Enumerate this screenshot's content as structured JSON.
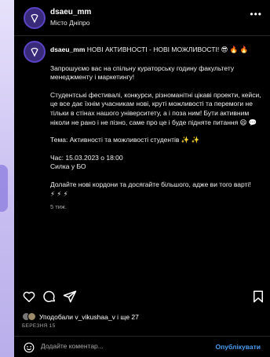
{
  "header": {
    "username": "dsaeu_mm",
    "location": "Місто Дніпро",
    "more_icon": "more-horizontal-icon"
  },
  "post": {
    "username": "dsaeu_mm",
    "title": "НОВІ АКТИВНОСТІ - НОВІ МОЖЛИВОСТІ!",
    "title_emoji": "😎 🔥 🔥",
    "paragraph1": "Запрошуємо вас на спільну кураторську годину факультету менеджменту і маркетингу!",
    "paragraph2": "Студентські фестивалі, конкурси, різноманітні цікаві проекти, кейси, це все дає їхнім учасникам нові, круті можливості та перемоги не тільки в стінах нашого університету, а і поза ним! Бути активним ніколи не рано і не пізно, саме про це і буде підняте питання",
    "paragraph2_emoji": "😄 💬",
    "topic": "Тема: Активності та можливості студентів",
    "topic_emoji": "✨ ✨",
    "time_line": "Час: 15.03.2023 о 18:00",
    "place_line": "Силка у БО",
    "paragraph3": "Долайте нові кордони та досягайте більшого, адже ви того варті!",
    "paragraph3_emoji": "⚡ ⚡ ⚡",
    "posted_ago": "5 тиж."
  },
  "actions": {
    "like_icon": "heart-icon",
    "comment_icon": "comment-icon",
    "share_icon": "share-icon",
    "save_icon": "bookmark-icon"
  },
  "likes": {
    "text": "Уподобали v_vikushaa_v і ще 27"
  },
  "date": "БЕРЕЗНЯ 15",
  "comment": {
    "placeholder": "Додайте коментар...",
    "publish_label": "Опублікувати",
    "emoji_icon": "smiley-icon"
  },
  "colors": {
    "background": "#000000",
    "text": "#f5f5f5",
    "muted": "#a8a8a8",
    "accent": "#4a9cf0",
    "page_backdrop": "#cfc8f2"
  }
}
